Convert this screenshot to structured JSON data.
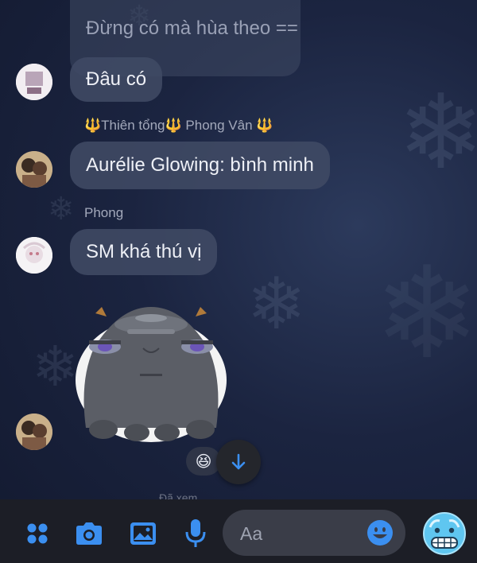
{
  "messages": [
    {
      "text": "Đừng có mà hùa theo =="
    },
    {
      "text": "Đâu có"
    },
    {
      "sender_prefix": "🔱",
      "sender_name1": "Thiên tổng",
      "sender_mid": "🔱",
      "sender_name2": " Phong Vân ",
      "sender_suffix": "🔱",
      "text": "Aurélie Glowing: bình minh"
    },
    {
      "sender": "Phong",
      "text": "SM khá thú vị"
    }
  ],
  "reaction_emoji": "😆",
  "seen_text": "Đã xem",
  "composer": {
    "placeholder": "Aa"
  },
  "colors": {
    "bubble": "#404a64",
    "accent": "#3b8ff0",
    "trident": "#f0a11a",
    "background": "#1b2440"
  },
  "icons": [
    "apps-icon",
    "camera-icon",
    "gallery-icon",
    "microphone-icon",
    "emoji-icon",
    "cold-face-emoji-icon",
    "scroll-down-arrow-icon"
  ]
}
